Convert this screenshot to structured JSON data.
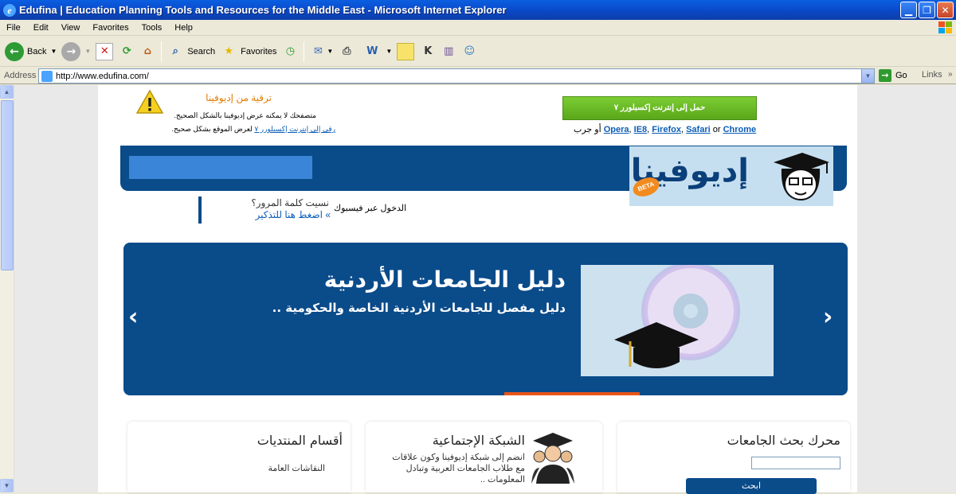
{
  "window": {
    "title": "Edufina | Education Planning Tools and Resources for the Middle East - Microsoft Internet Explorer",
    "buttons": {
      "minimize": "▁",
      "restore": "❐",
      "close": "✕"
    }
  },
  "menu": [
    "File",
    "Edit",
    "View",
    "Favorites",
    "Tools",
    "Help"
  ],
  "toolbar": {
    "back": "Back",
    "search": "Search",
    "favorites": "Favorites"
  },
  "address": {
    "label": "Address",
    "url": "http://www.edufina.com/",
    "go": "Go",
    "links": "Links"
  },
  "warning": {
    "title": "ترقية من إديوفينا",
    "line1": "متصفحك لا يمكنه عرض إديوفينا بالشكل الصحيح.",
    "line2_link": "رقي إلى إنترنت إكسبلورر ٧",
    "line2_rest": "لعرض الموقع بشكل صحيح.",
    "button": "حمل إلى إنترنت إكسبلورر ٧",
    "alt_prefix": "أو جرب",
    "browsers": [
      "Opera",
      "IE8",
      "Firefox",
      "Safari"
    ],
    "or": "or",
    "last_browser": "Chrome"
  },
  "header": {
    "logo_text": "إديوفينا",
    "beta": "BETA"
  },
  "login": {
    "facebook": "الدخول عبر فيسبوك",
    "forgot": "نسيت كلمة المرور؟",
    "remind": "» اضغط هنا للتذكير"
  },
  "slider": {
    "title": "دليل الجامعات الأردنية",
    "subtitle": "دليل مفصل للجامعات الأردنية الخاصة والحكومية ..",
    "prev": "‹",
    "next": "›"
  },
  "panels": {
    "search": {
      "title": "محرك بحث الجامعات",
      "button": "ابحث"
    },
    "social": {
      "title": "الشبكة الإجتماعية",
      "text": "انضم إلى شبكة إديوفينا وكون علاقات مع طلاب الجامعات العربية وتبادل المعلومات .."
    },
    "forums": {
      "title": "أقسام المنتديات",
      "items": [
        "النقاشات العامة"
      ]
    }
  },
  "colors": {
    "brand_blue": "#0a4b8a",
    "accent_orange": "#e8561a",
    "button_green": "#5aa71b"
  }
}
